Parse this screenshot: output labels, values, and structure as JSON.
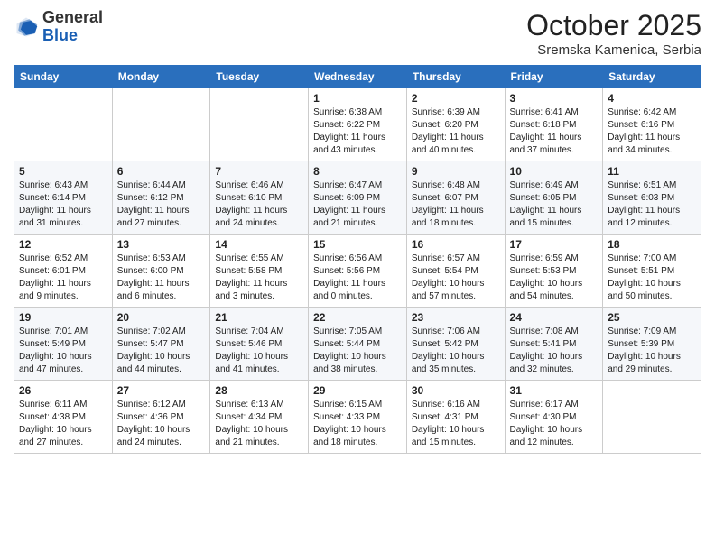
{
  "logo": {
    "general": "General",
    "blue": "Blue"
  },
  "header": {
    "month": "October 2025",
    "location": "Sremska Kamenica, Serbia"
  },
  "weekdays": [
    "Sunday",
    "Monday",
    "Tuesday",
    "Wednesday",
    "Thursday",
    "Friday",
    "Saturday"
  ],
  "weeks": [
    [
      {
        "day": "",
        "info": ""
      },
      {
        "day": "",
        "info": ""
      },
      {
        "day": "",
        "info": ""
      },
      {
        "day": "1",
        "info": "Sunrise: 6:38 AM\nSunset: 6:22 PM\nDaylight: 11 hours\nand 43 minutes."
      },
      {
        "day": "2",
        "info": "Sunrise: 6:39 AM\nSunset: 6:20 PM\nDaylight: 11 hours\nand 40 minutes."
      },
      {
        "day": "3",
        "info": "Sunrise: 6:41 AM\nSunset: 6:18 PM\nDaylight: 11 hours\nand 37 minutes."
      },
      {
        "day": "4",
        "info": "Sunrise: 6:42 AM\nSunset: 6:16 PM\nDaylight: 11 hours\nand 34 minutes."
      }
    ],
    [
      {
        "day": "5",
        "info": "Sunrise: 6:43 AM\nSunset: 6:14 PM\nDaylight: 11 hours\nand 31 minutes."
      },
      {
        "day": "6",
        "info": "Sunrise: 6:44 AM\nSunset: 6:12 PM\nDaylight: 11 hours\nand 27 minutes."
      },
      {
        "day": "7",
        "info": "Sunrise: 6:46 AM\nSunset: 6:10 PM\nDaylight: 11 hours\nand 24 minutes."
      },
      {
        "day": "8",
        "info": "Sunrise: 6:47 AM\nSunset: 6:09 PM\nDaylight: 11 hours\nand 21 minutes."
      },
      {
        "day": "9",
        "info": "Sunrise: 6:48 AM\nSunset: 6:07 PM\nDaylight: 11 hours\nand 18 minutes."
      },
      {
        "day": "10",
        "info": "Sunrise: 6:49 AM\nSunset: 6:05 PM\nDaylight: 11 hours\nand 15 minutes."
      },
      {
        "day": "11",
        "info": "Sunrise: 6:51 AM\nSunset: 6:03 PM\nDaylight: 11 hours\nand 12 minutes."
      }
    ],
    [
      {
        "day": "12",
        "info": "Sunrise: 6:52 AM\nSunset: 6:01 PM\nDaylight: 11 hours\nand 9 minutes."
      },
      {
        "day": "13",
        "info": "Sunrise: 6:53 AM\nSunset: 6:00 PM\nDaylight: 11 hours\nand 6 minutes."
      },
      {
        "day": "14",
        "info": "Sunrise: 6:55 AM\nSunset: 5:58 PM\nDaylight: 11 hours\nand 3 minutes."
      },
      {
        "day": "15",
        "info": "Sunrise: 6:56 AM\nSunset: 5:56 PM\nDaylight: 11 hours\nand 0 minutes."
      },
      {
        "day": "16",
        "info": "Sunrise: 6:57 AM\nSunset: 5:54 PM\nDaylight: 10 hours\nand 57 minutes."
      },
      {
        "day": "17",
        "info": "Sunrise: 6:59 AM\nSunset: 5:53 PM\nDaylight: 10 hours\nand 54 minutes."
      },
      {
        "day": "18",
        "info": "Sunrise: 7:00 AM\nSunset: 5:51 PM\nDaylight: 10 hours\nand 50 minutes."
      }
    ],
    [
      {
        "day": "19",
        "info": "Sunrise: 7:01 AM\nSunset: 5:49 PM\nDaylight: 10 hours\nand 47 minutes."
      },
      {
        "day": "20",
        "info": "Sunrise: 7:02 AM\nSunset: 5:47 PM\nDaylight: 10 hours\nand 44 minutes."
      },
      {
        "day": "21",
        "info": "Sunrise: 7:04 AM\nSunset: 5:46 PM\nDaylight: 10 hours\nand 41 minutes."
      },
      {
        "day": "22",
        "info": "Sunrise: 7:05 AM\nSunset: 5:44 PM\nDaylight: 10 hours\nand 38 minutes."
      },
      {
        "day": "23",
        "info": "Sunrise: 7:06 AM\nSunset: 5:42 PM\nDaylight: 10 hours\nand 35 minutes."
      },
      {
        "day": "24",
        "info": "Sunrise: 7:08 AM\nSunset: 5:41 PM\nDaylight: 10 hours\nand 32 minutes."
      },
      {
        "day": "25",
        "info": "Sunrise: 7:09 AM\nSunset: 5:39 PM\nDaylight: 10 hours\nand 29 minutes."
      }
    ],
    [
      {
        "day": "26",
        "info": "Sunrise: 6:11 AM\nSunset: 4:38 PM\nDaylight: 10 hours\nand 27 minutes."
      },
      {
        "day": "27",
        "info": "Sunrise: 6:12 AM\nSunset: 4:36 PM\nDaylight: 10 hours\nand 24 minutes."
      },
      {
        "day": "28",
        "info": "Sunrise: 6:13 AM\nSunset: 4:34 PM\nDaylight: 10 hours\nand 21 minutes."
      },
      {
        "day": "29",
        "info": "Sunrise: 6:15 AM\nSunset: 4:33 PM\nDaylight: 10 hours\nand 18 minutes."
      },
      {
        "day": "30",
        "info": "Sunrise: 6:16 AM\nSunset: 4:31 PM\nDaylight: 10 hours\nand 15 minutes."
      },
      {
        "day": "31",
        "info": "Sunrise: 6:17 AM\nSunset: 4:30 PM\nDaylight: 10 hours\nand 12 minutes."
      },
      {
        "day": "",
        "info": ""
      }
    ]
  ]
}
